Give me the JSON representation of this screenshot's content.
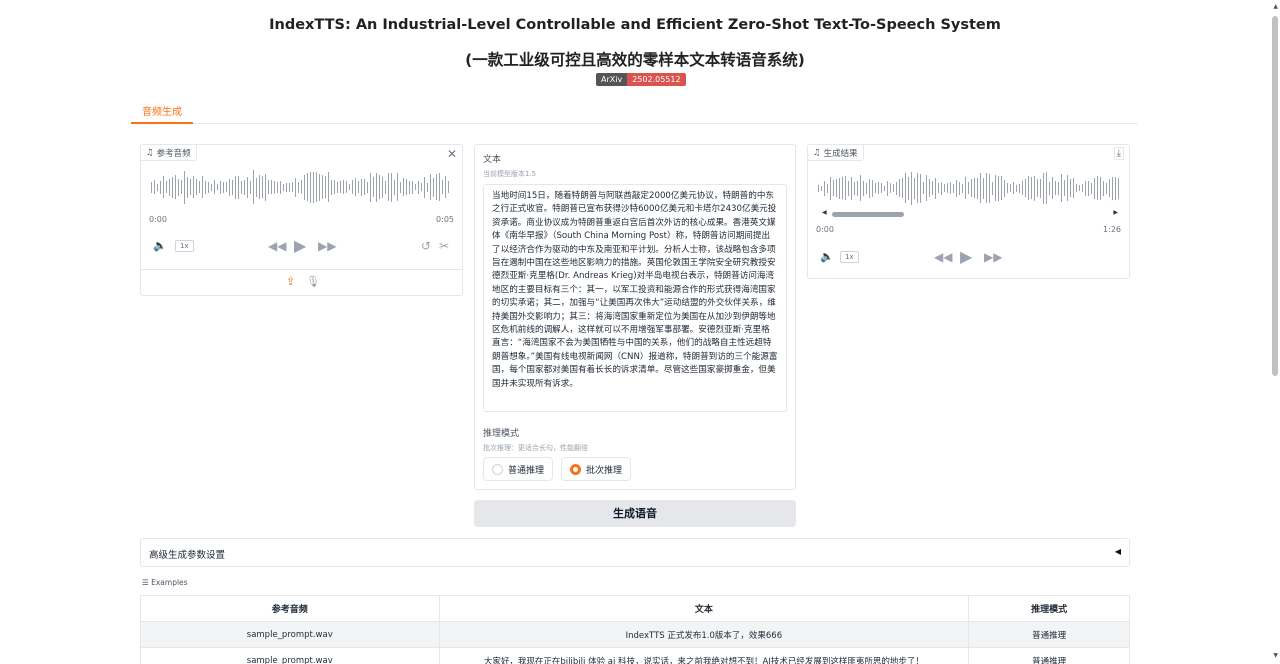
{
  "header": {
    "title": "IndexTTS: An Industrial-Level Controllable and Efficient Zero-Shot Text-To-Speech System",
    "subtitle": "(一款工业级可控且高效的零样本文本转语音系统)",
    "badge_left": "ArXiv",
    "badge_right": "2502.05512"
  },
  "tabs": [
    {
      "label": "音频生成",
      "active": true
    }
  ],
  "ref_audio": {
    "label": "参考音频",
    "time_start": "0:00",
    "time_end": "0:05",
    "rate": "1x"
  },
  "text_field": {
    "label": "文本",
    "hint": "当前模型版本1.5",
    "value": "当地时间15日，随着特朗普与阿联酋敲定2000亿美元协议，特朗普的中东之行正式收官。特朗普已宣布获得沙特6000亿美元和卡塔尔2430亿美元投资承诺。商业协议成为特朗普重返白宫后首次外访的核心成果。香港英文媒体《南华早报》（South China Morning Post）称，特朗普访问期间提出了以经济合作为驱动的中东及南亚和平计划。分析人士称，该战略包含多项旨在遏制中国在这些地区影响力的措施。英国伦敦国王学院安全研究教授安德烈亚斯·克里格(Dr. Andreas Krieg)对半岛电视台表示，特朗普访问海湾地区的主要目标有三个：其一，以军工投资和能源合作的形式获得海湾国家的切实承诺；其二，加强与“让美国再次伟大”运动结盟的外交伙伴关系，维持美国外交影响力；其三：将海湾国家重新定位为美国在从加沙到伊朗等地区危机前线的调解人，这样就可以不用增强军事部署。安德烈亚斯·克里格直言：“海湾国家不会为美国牺牲与中国的关系，他们的战略自主性远超特朗普想象。”美国有线电视新闻网（CNN）报道称，特朗普到访的三个能源富国，每个国家都对美国有着长长的诉求清单。尽管这些国家豪掷重金，但美国并未实现所有诉求。"
  },
  "infer_mode": {
    "label": "推理模式",
    "hint": "批次推理：更适合长句，性能翻倍",
    "options": [
      "普通推理",
      "批次推理"
    ],
    "selected": "批次推理"
  },
  "result_audio": {
    "label": "生成结果",
    "time_start": "0:00",
    "time_end": "1:26",
    "rate": "1x"
  },
  "generate_button": "生成语音",
  "advanced": {
    "label": "高级生成参数设置",
    "arrow": "◀"
  },
  "examples": {
    "label": "Examples",
    "headers": [
      "参考音频",
      "文本",
      "推理模式"
    ],
    "rows": [
      [
        "sample_prompt.wav",
        "IndexTTS 正式发布1.0版本了，效果666",
        "普通推理"
      ],
      [
        "sample_prompt.wav",
        "大家好，我现在正在bilibili 体验 ai 科技，说实话，来之前我绝对想不到！AI技术已经发展到这样匪夷所思的地步了！",
        "普通推理"
      ]
    ]
  },
  "colors": {
    "accent": "#f97316",
    "badge_right": "#d9534f",
    "badge_left": "#555555"
  }
}
